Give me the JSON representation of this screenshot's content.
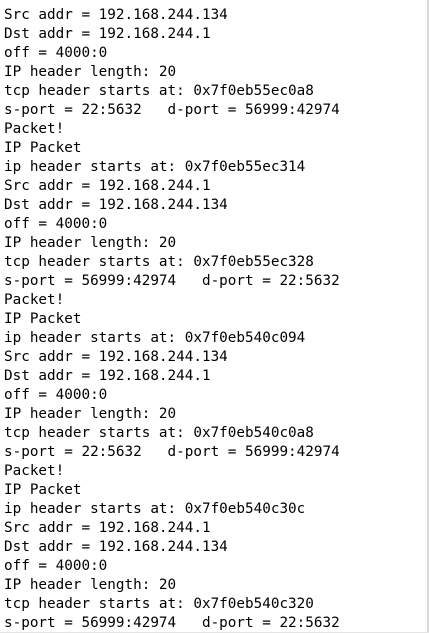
{
  "terminal": {
    "lines": [
      "Src addr = 192.168.244.134",
      "Dst addr = 192.168.244.1",
      "off = 4000:0",
      "IP header length: 20",
      "tcp header starts at: 0x7f0eb55ec0a8",
      "s-port = 22:5632   d-port = 56999:42974",
      "Packet!",
      "IP Packet",
      "ip header starts at: 0x7f0eb55ec314",
      "Src addr = 192.168.244.1",
      "Dst addr = 192.168.244.134",
      "off = 4000:0",
      "IP header length: 20",
      "tcp header starts at: 0x7f0eb55ec328",
      "s-port = 56999:42974   d-port = 22:5632",
      "Packet!",
      "IP Packet",
      "ip header starts at: 0x7f0eb540c094",
      "Src addr = 192.168.244.134",
      "Dst addr = 192.168.244.1",
      "off = 4000:0",
      "IP header length: 20",
      "tcp header starts at: 0x7f0eb540c0a8",
      "s-port = 22:5632   d-port = 56999:42974",
      "Packet!",
      "IP Packet",
      "ip header starts at: 0x7f0eb540c30c",
      "Src addr = 192.168.244.1",
      "Dst addr = 192.168.244.134",
      "off = 4000:0",
      "IP header length: 20",
      "tcp header starts at: 0x7f0eb540c320",
      "s-port = 56999:42974   d-port = 22:5632"
    ]
  }
}
